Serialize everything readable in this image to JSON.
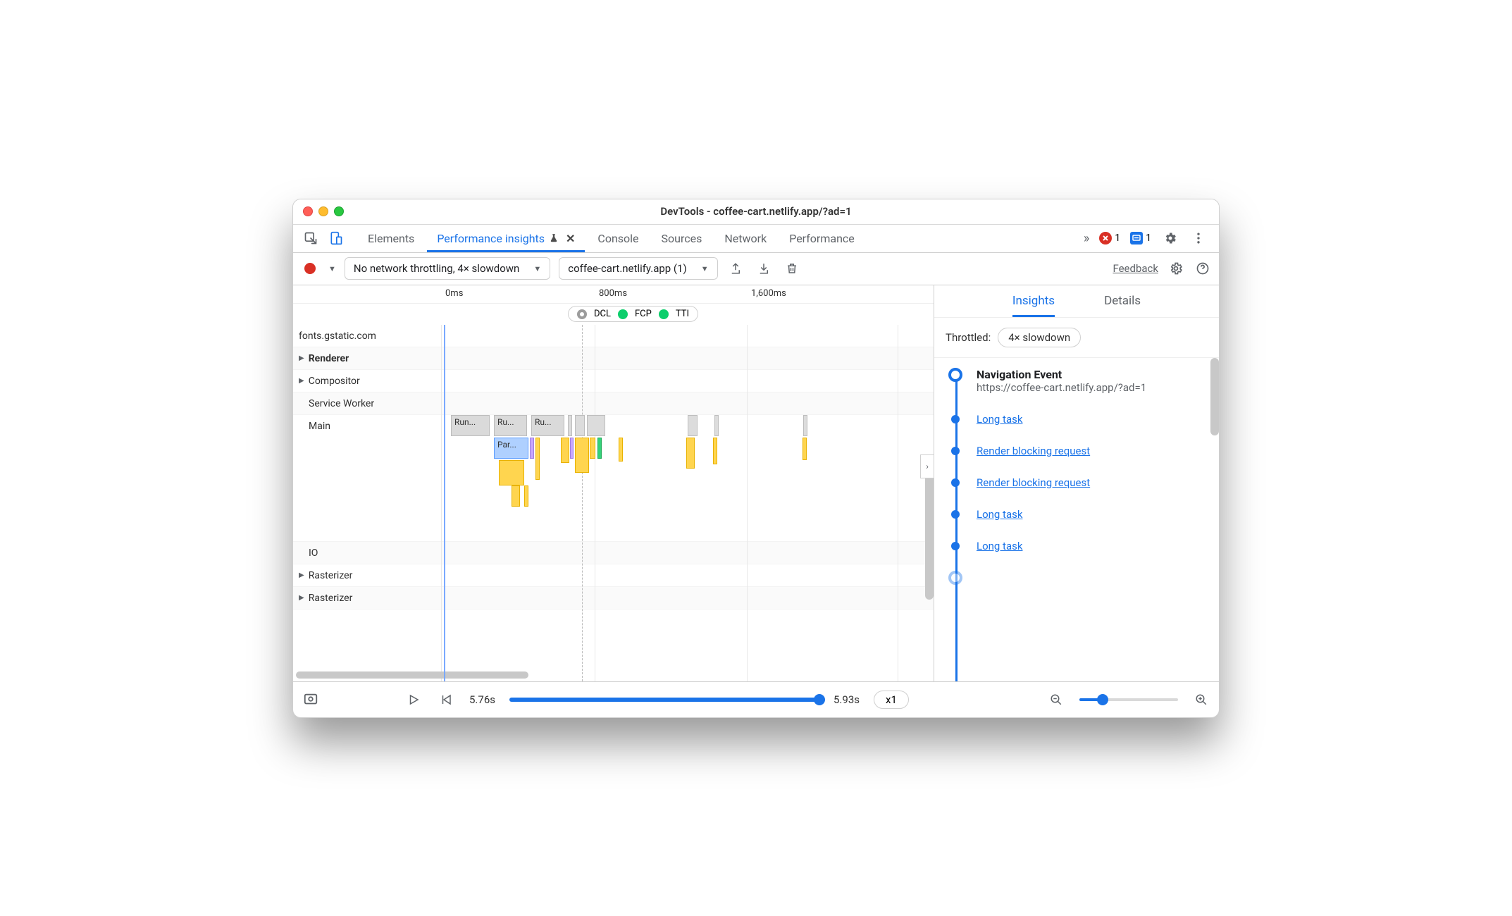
{
  "window": {
    "title": "DevTools - coffee-cart.netlify.app/?ad=1"
  },
  "tabs": {
    "elements": "Elements",
    "perf_insights": "Performance insights",
    "console": "Console",
    "sources": "Sources",
    "network": "Network",
    "performance": "Performance",
    "more": "»",
    "errors_count": "1",
    "messages_count": "1"
  },
  "toolbar": {
    "throttle": "No network throttling, 4× slowdown",
    "target": "coffee-cart.netlify.app (1)",
    "feedback": "Feedback"
  },
  "ruler": {
    "t0": "0ms",
    "t1": "800ms",
    "t2": "1,600ms"
  },
  "metrics": {
    "dcl": "DCL",
    "fcp": "FCP",
    "tti": "TTI"
  },
  "tracks": {
    "fonts": "fonts.gstatic.com",
    "renderer": "Renderer",
    "compositor": "Compositor",
    "service_worker": "Service Worker",
    "main": "Main",
    "io": "IO",
    "raster1": "Rasterizer",
    "raster2": "Rasterizer"
  },
  "bars": {
    "run1": "Run...",
    "run2": "Ru...",
    "run3": "Ru...",
    "par": "Par..."
  },
  "side": {
    "insights_tab": "Insights",
    "details_tab": "Details",
    "throttled_label": "Throttled:",
    "throttled_value": "4× slowdown",
    "nav_title": "Navigation Event",
    "nav_url": "https://coffee-cart.netlify.app/?ad=1",
    "items": {
      "i0": "Long task",
      "i1": "Render blocking request",
      "i2": "Render blocking request",
      "i3": "Long task",
      "i4": "Long task"
    }
  },
  "footer": {
    "current": "5.76s",
    "total": "5.93s",
    "zoom_label": "x1"
  }
}
